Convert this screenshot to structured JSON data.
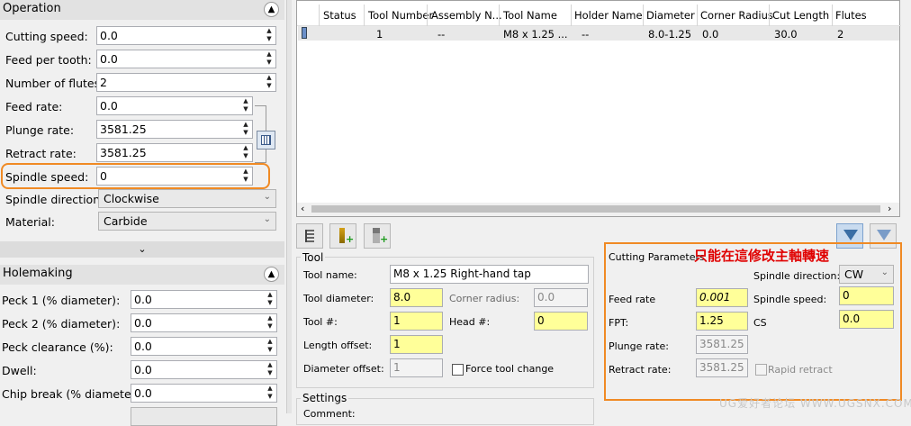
{
  "operation": {
    "title": "Operation",
    "fields": [
      {
        "label": "Cutting speed:",
        "value": "0.0"
      },
      {
        "label": "Feed per tooth:",
        "value": "0.0"
      },
      {
        "label": "Number of flutes:",
        "value": "2"
      },
      {
        "label": "Feed rate:",
        "value": "0.0"
      },
      {
        "label": "Plunge rate:",
        "value": "3581.25"
      },
      {
        "label": "Retract rate:",
        "value": "3581.25"
      },
      {
        "label": "Spindle speed:",
        "value": "0"
      }
    ],
    "spindle_direction": {
      "label": "Spindle direction:",
      "value": "Clockwise"
    },
    "material": {
      "label": "Material:",
      "value": "Carbide"
    }
  },
  "holemaking": {
    "title": "Holemaking",
    "fields": [
      {
        "label": "Peck 1 (% diameter):",
        "value": "0.0"
      },
      {
        "label": "Peck 2 (% diameter):",
        "value": "0.0"
      },
      {
        "label": "Peck clearance (%):",
        "value": "0.0"
      },
      {
        "label": "Dwell:",
        "value": "0.0"
      },
      {
        "label": "Chip break (% diameter):",
        "value": "0.0"
      }
    ]
  },
  "grid": {
    "headers": [
      "Status",
      "Tool Number",
      "Assembly N...",
      "Tool Name",
      "Holder Name",
      "Diameter",
      "Corner Radius",
      "Cut Length",
      "Flutes"
    ],
    "row": [
      "",
      "1",
      "--",
      "M8 x 1.25 ...",
      "--",
      "8.0-1.25",
      "0.0",
      "30.0",
      "2"
    ]
  },
  "tool": {
    "title": "Tool",
    "name_label": "Tool name:",
    "name_value": "M8 x 1.25 Right-hand tap",
    "diameter_label": "Tool diameter:",
    "diameter_value": "8.0",
    "corner_label": "Corner radius:",
    "corner_value": "0.0",
    "number_label": "Tool #:",
    "number_value": "1",
    "head_label": "Head #:",
    "head_value": "0",
    "length_label": "Length offset:",
    "length_value": "1",
    "dia_off_label": "Diameter offset:",
    "dia_off_value": "1",
    "force_change_label": "Force tool change"
  },
  "settings": {
    "title": "Settings",
    "comment_label": "Comment:"
  },
  "cutting": {
    "title": "Cutting Parameters",
    "annotation": "只能在這修改主軸轉速",
    "feed_label": "Feed rate",
    "feed_value": "0.001",
    "fpt_label": "FPT:",
    "fpt_value": "1.25",
    "plunge_label": "Plunge rate:",
    "plunge_value": "3581.25",
    "retract_label": "Retract rate:",
    "retract_value": "3581.25",
    "spindle_dir_label": "Spindle direction:",
    "spindle_dir_value": "CW",
    "spindle_speed_label": "Spindle speed:",
    "spindle_speed_value": "0",
    "cs_label": "CS",
    "cs_value": "0.0",
    "rapid_label": "Rapid retract"
  },
  "watermark": "UG爱好者论坛 WWW.UGSNX.COM",
  "colors": {
    "highlight": "#f08a24",
    "annotation": "#e00000",
    "yellow_field": "#ffff99"
  }
}
